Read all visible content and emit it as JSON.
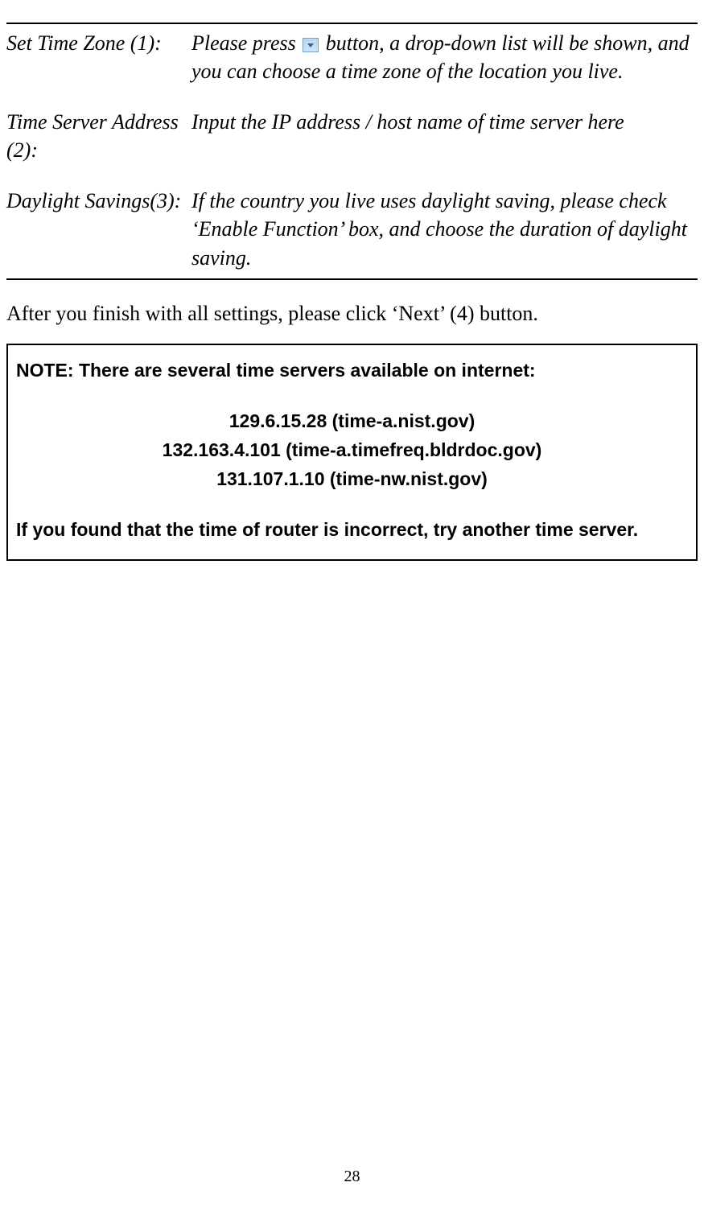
{
  "definitions": [
    {
      "label": "Set Time Zone (1):",
      "desc_before": "Please press ",
      "desc_after": " button, a drop-down list will be shown, and you can choose a time zone of the location you live.",
      "has_icon": true
    },
    {
      "label": "Time Server Address (2):",
      "desc": "Input the IP address / host name of time server here",
      "has_icon": false
    },
    {
      "label": "Daylight Savings(3):",
      "desc": "If the country you live uses daylight saving, please check ‘Enable Function’ box, and choose the duration of daylight saving.",
      "has_icon": false
    }
  ],
  "after_text": "After you finish with all settings, please click ‘Next’ (4) button.",
  "note": {
    "heading": "NOTE: There are several time servers available on internet:",
    "servers": [
      "129.6.15.28 (time-a.nist.gov)",
      "132.163.4.101 (time-a.timefreq.bldrdoc.gov)",
      "131.107.1.10 (time-nw.nist.gov)"
    ],
    "footer": "If you found that the time of router is incorrect, try another time server."
  },
  "page_number": "28"
}
